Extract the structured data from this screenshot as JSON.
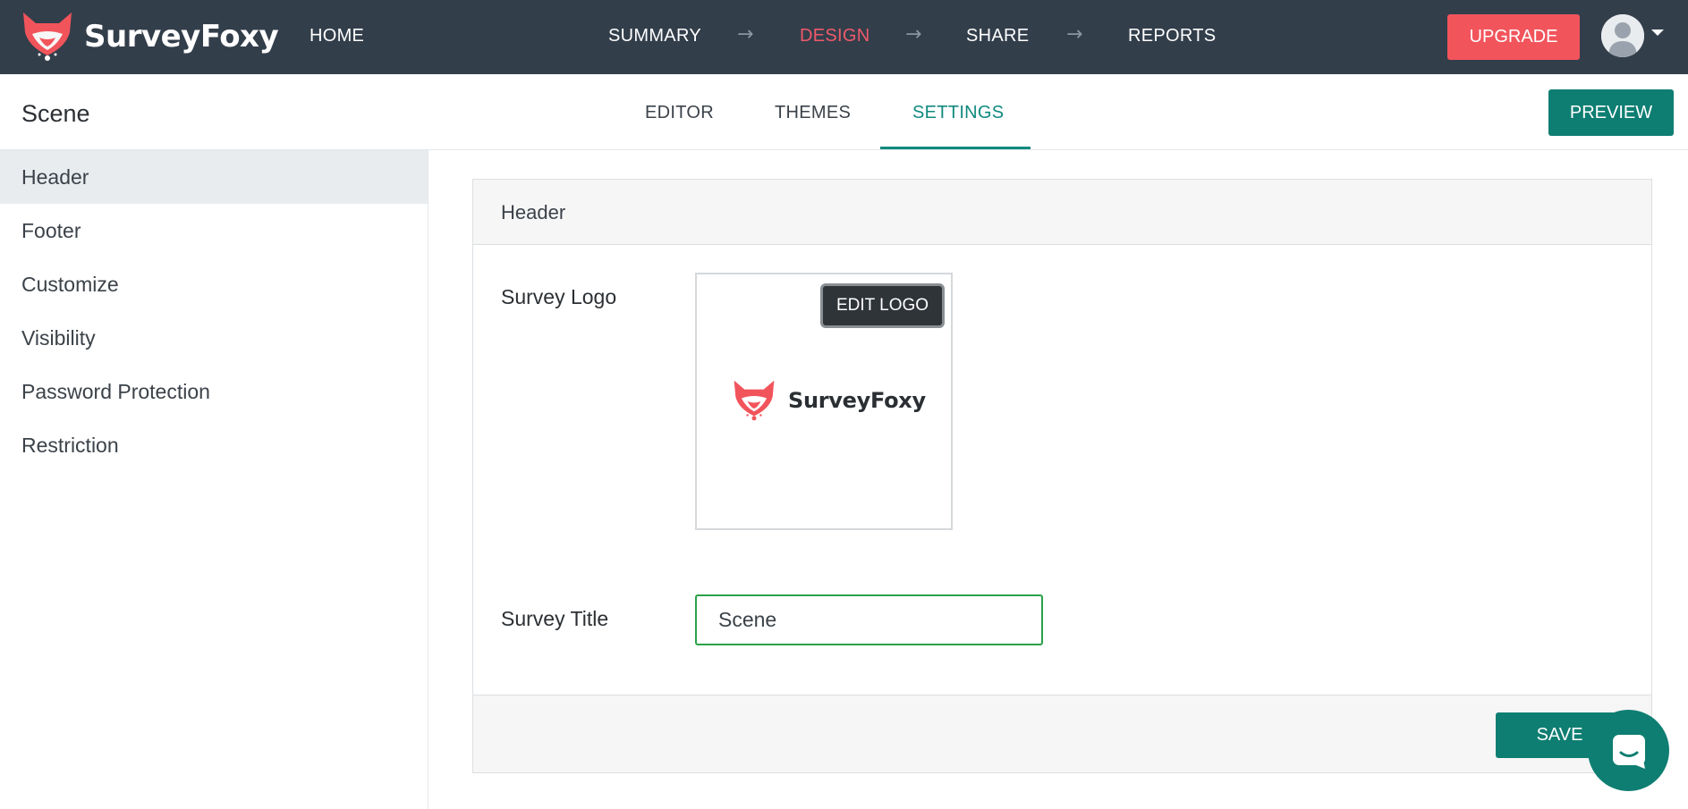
{
  "topnav": {
    "brand": "SurveyFoxy",
    "home": "HOME",
    "steps": [
      "SUMMARY",
      "DESIGN",
      "SHARE",
      "REPORTS"
    ],
    "active_step": "DESIGN",
    "arrow": "→",
    "upgrade": "UPGRADE"
  },
  "subheader": {
    "survey_name": "Scene",
    "tabs": [
      "EDITOR",
      "THEMES",
      "SETTINGS"
    ],
    "active_tab": "SETTINGS",
    "preview": "PREVIEW"
  },
  "sidebar": {
    "items": [
      "Header",
      "Footer",
      "Customize",
      "Visibility",
      "Password Protection",
      "Restriction"
    ],
    "active": "Header"
  },
  "panel": {
    "title": "Header",
    "logo_label": "Survey Logo",
    "edit_logo": "EDIT LOGO",
    "logo_text": "SurveyFoxy",
    "title_label": "Survey Title",
    "title_value": "Scene",
    "save": "SAVE"
  },
  "colors": {
    "topbar": "#333e4b",
    "accent_teal": "#0f7e72",
    "active_pink": "#f05a6a",
    "upgrade": "#f2545b",
    "fox": "#f2545b"
  },
  "icons": {
    "brand": "fox-logo-icon",
    "avatar": "user-avatar-icon",
    "caret": "caret-down-icon",
    "chat": "chat-icon"
  }
}
